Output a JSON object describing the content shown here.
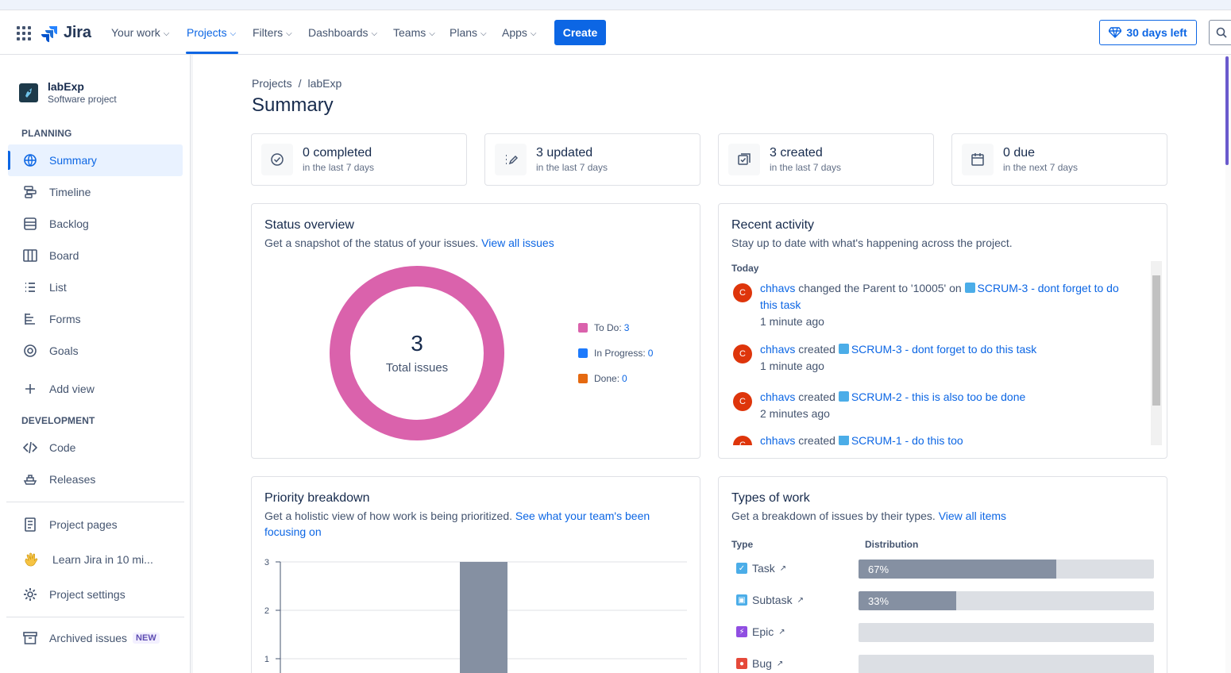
{
  "topnav": {
    "app_name": "Jira",
    "items": [
      {
        "label": "Your work"
      },
      {
        "label": "Projects"
      },
      {
        "label": "Filters"
      },
      {
        "label": "Dashboards"
      },
      {
        "label": "Teams"
      },
      {
        "label": "Plans"
      },
      {
        "label": "Apps"
      }
    ],
    "create_label": "Create",
    "trial_label": "30 days left"
  },
  "sidebar": {
    "project_name": "labExp",
    "project_type": "Software project",
    "planning_label": "PLANNING",
    "development_label": "DEVELOPMENT",
    "planning_items": [
      {
        "label": "Summary"
      },
      {
        "label": "Timeline"
      },
      {
        "label": "Backlog"
      },
      {
        "label": "Board"
      },
      {
        "label": "List"
      },
      {
        "label": "Forms"
      },
      {
        "label": "Goals"
      }
    ],
    "add_view_label": "Add view",
    "development_items": [
      {
        "label": "Code"
      },
      {
        "label": "Releases"
      }
    ],
    "bottom_items": [
      {
        "label": "Project pages"
      },
      {
        "label": "Learn Jira in 10 mi..."
      },
      {
        "label": "Project settings"
      }
    ],
    "archived_label": "Archived issues",
    "new_badge": "NEW"
  },
  "main": {
    "breadcrumb": [
      "Projects",
      "/",
      "labExp"
    ],
    "title": "Summary",
    "stats": [
      {
        "main": "0 completed",
        "sub": "in the last 7 days"
      },
      {
        "main": "3 updated",
        "sub": "in the last 7 days"
      },
      {
        "main": "3 created",
        "sub": "in the last 7 days"
      },
      {
        "main": "0 due",
        "sub": "in the next 7 days"
      }
    ]
  },
  "status_overview": {
    "title": "Status overview",
    "desc": "Get a snapshot of the status of your issues.",
    "link": "View all issues",
    "total": "3",
    "total_label": "Total issues",
    "legend": [
      {
        "label": "To Do:",
        "value": "3",
        "color": "#da62ac"
      },
      {
        "label": "In Progress:",
        "value": "0",
        "color": "#1d7afc"
      },
      {
        "label": "Done:",
        "value": "0",
        "color": "#e56910"
      }
    ]
  },
  "recent_activity": {
    "title": "Recent activity",
    "desc": "Stay up to date with what's happening across the project.",
    "day": "Today",
    "items": [
      {
        "avatar": "C",
        "user": "chhavs",
        "action": "changed the Parent to '10005' on",
        "issue": "SCRUM-3 - dont forget to do this task",
        "time": "1 minute ago"
      },
      {
        "avatar": "C",
        "user": "chhavs",
        "action": "created",
        "issue": "SCRUM-3 - dont forget to do this task",
        "time": "1 minute ago"
      },
      {
        "avatar": "C",
        "user": "chhavs",
        "action": "created",
        "issue": "SCRUM-2 - this is also too be done",
        "time": "2 minutes ago"
      },
      {
        "avatar": "C",
        "user": "chhavs",
        "action": "created",
        "issue": "SCRUM-1 - do this too",
        "time": ""
      }
    ]
  },
  "priority_breakdown": {
    "title": "Priority breakdown",
    "desc": "Get a holistic view of how work is being prioritized.",
    "link": "See what your team's been focusing on"
  },
  "chart_data": {
    "type": "bar",
    "values": [
      3
    ],
    "ylim": [
      0,
      3
    ],
    "yticks": [
      "3",
      "2",
      "1"
    ],
    "color": "#8590a2"
  },
  "types_of_work": {
    "title": "Types of work",
    "desc": "Get a breakdown of issues by their types.",
    "link": "View all items",
    "col_type": "Type",
    "col_dist": "Distribution",
    "rows": [
      {
        "name": "Task",
        "percent": 67,
        "label": "67%",
        "icon_color": "#4bade8",
        "icon": "check-icon"
      },
      {
        "name": "Subtask",
        "percent": 33,
        "label": "33%",
        "icon_color": "#4bade8",
        "icon": "subtask-icon"
      },
      {
        "name": "Epic",
        "percent": 0,
        "label": "",
        "icon_color": "#904ee2",
        "icon": "bolt-icon"
      },
      {
        "name": "Bug",
        "percent": 0,
        "label": "",
        "icon_color": "#e5493a",
        "icon": "dot-icon"
      }
    ]
  }
}
